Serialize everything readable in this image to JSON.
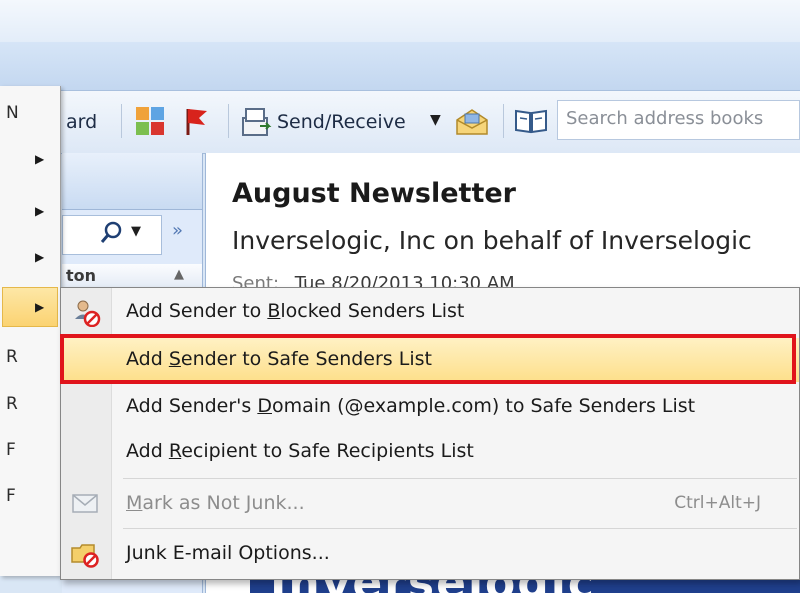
{
  "toolbar": {
    "forward_label_partial": "ard",
    "send_receive_label": "Send/Receive",
    "search_placeholder": "Search address books"
  },
  "parent_menu": {
    "glyphs": [
      "N",
      "R",
      "R",
      "F",
      "F"
    ]
  },
  "nav_pane": {
    "column_header_partial": "ton"
  },
  "reading_pane": {
    "subject": "August Newsletter",
    "sender": "Inverselogic, Inc on behalf of Inverselogic",
    "sent_label": "Sent:",
    "sent_value": "Tue 8/20/2013 10:30 AM",
    "banner_text": "Inverselogic"
  },
  "junk_submenu": {
    "items": [
      {
        "pre": "Add Sender to ",
        "key": "B",
        "post": "locked Senders List"
      },
      {
        "pre": "Add ",
        "key": "S",
        "post": "ender to Safe Senders List"
      },
      {
        "pre": "Add Sender's ",
        "key": "D",
        "post": "omain (@example.com) to Safe Senders List"
      },
      {
        "pre": "Add ",
        "key": "R",
        "post": "ecipient to Safe Recipients List"
      },
      {
        "pre": "",
        "key": "M",
        "post": "ark as Not Junk...",
        "shortcut": "Ctrl+Alt+J"
      },
      {
        "pre": "",
        "key": "J",
        "post": "unk E-mail Options..."
      }
    ]
  },
  "colors": {
    "highlight_border": "#e0141b",
    "hover_fill": "#fddf8a"
  },
  "icons": [
    "blocked-sender-icon",
    "envelope-icon",
    "junk-options-icon",
    "flag-icon",
    "categorize-icon",
    "send-receive-icon",
    "address-book-icon"
  ]
}
